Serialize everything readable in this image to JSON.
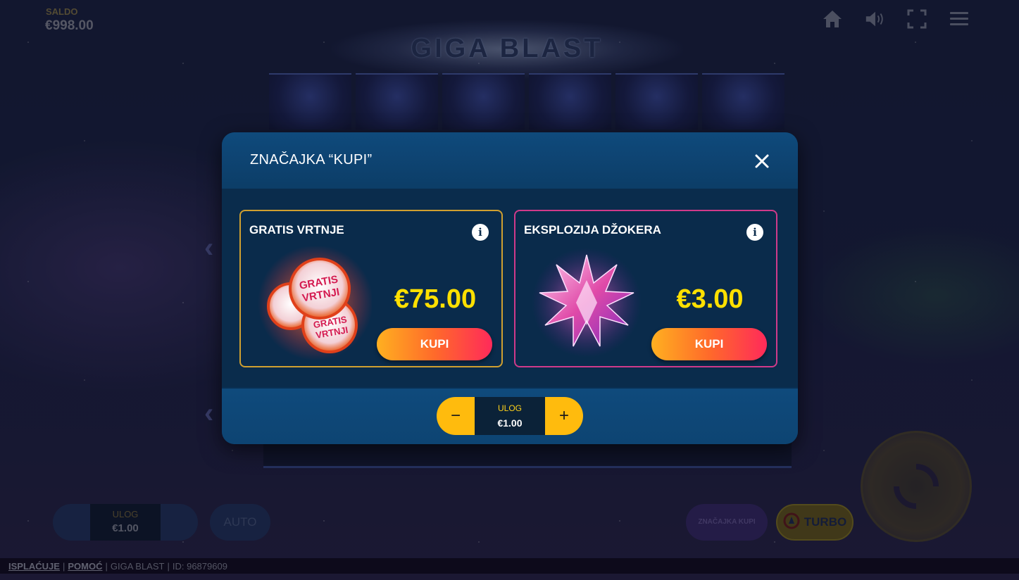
{
  "game": {
    "title": "GIGA BLAST",
    "balance_label": "SALDO",
    "balance_value": "€998.00"
  },
  "top_icons": [
    "home-icon",
    "sound-icon",
    "fullscreen-icon",
    "menu-icon"
  ],
  "bottom_controls": {
    "bet_label": "ULOG",
    "bet_value": "€1.00",
    "auto_label": "AUTO",
    "buy_feature_label": "ZNAČAJKA KUPI",
    "turbo_label": "TURBO"
  },
  "footer": {
    "payouts_link": "ISPLAĆUJE",
    "help_link": "POMOĆ",
    "game_name": "GIGA BLAST",
    "id_text": "ID: 96879609"
  },
  "modal": {
    "title": "ZNAČAJKA “KUPI”",
    "cards": [
      {
        "title": "GRATIS VRTNJE",
        "price": "€75.00",
        "buy_label": "KUPI",
        "art_text": "GRATIS VRTNJI"
      },
      {
        "title": "EKSPLOZIJA DŽOKERA",
        "price": "€3.00",
        "buy_label": "KUPI"
      }
    ],
    "stake": {
      "label": "ULOG",
      "value": "€1.00",
      "minus": "−",
      "plus": "+"
    }
  },
  "colors": {
    "price_yellow": "#ffe000",
    "card1_border": "#d0a030",
    "card2_border": "#d03a8a",
    "stepper_yellow": "#ffbb0d"
  }
}
